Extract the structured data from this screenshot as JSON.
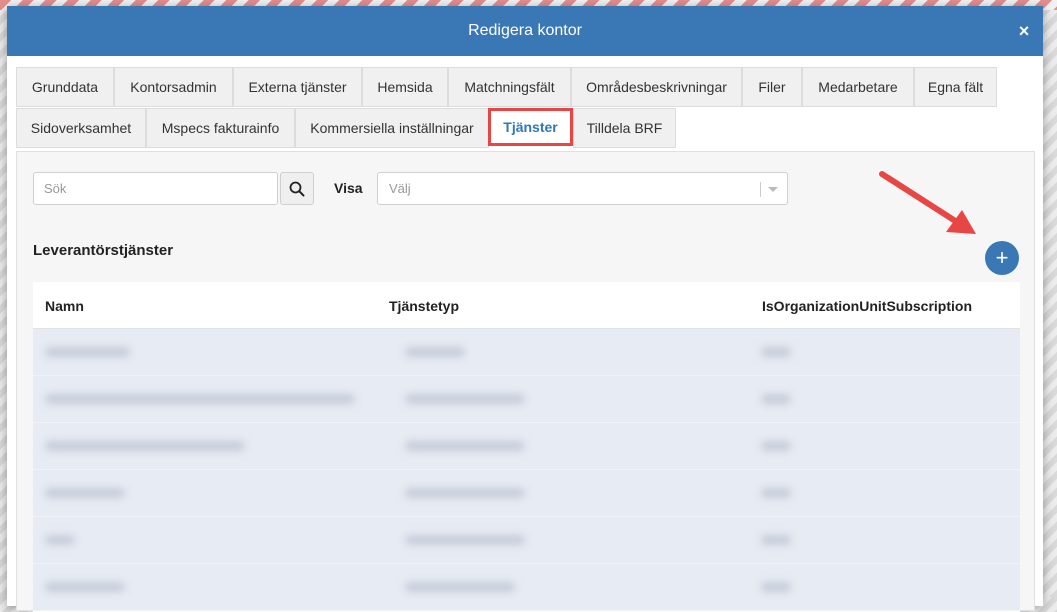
{
  "modal": {
    "title": "Redigera kontor",
    "close_glyph": "×"
  },
  "tabs": [
    {
      "label": "Grunddata",
      "active": false
    },
    {
      "label": "Kontorsadmin",
      "active": false
    },
    {
      "label": "Externa tjänster",
      "active": false
    },
    {
      "label": "Hemsida",
      "active": false
    },
    {
      "label": "Matchningsfält",
      "active": false
    },
    {
      "label": "Områdesbeskrivningar",
      "active": false
    },
    {
      "label": "Filer",
      "active": false
    },
    {
      "label": "Medarbetare",
      "active": false
    },
    {
      "label": "Egna fält",
      "active": false
    },
    {
      "label": "Sidoverksamhet",
      "active": false
    },
    {
      "label": "Mspecs fakturainfo",
      "active": false
    },
    {
      "label": "Kommersiella inställningar",
      "active": false
    },
    {
      "label": "Tjänster",
      "active": true
    },
    {
      "label": "Tilldela BRF",
      "active": false
    }
  ],
  "filters": {
    "search_placeholder": "Sök",
    "search_value": "",
    "search_icon": "search-icon",
    "visa_label": "Visa",
    "select_value": "Välj"
  },
  "section": {
    "title": "Leverantörstjänster",
    "add_glyph": "+"
  },
  "table": {
    "columns": [
      "Namn",
      "Tjänstetyp",
      "IsOrganizationUnitSubscription"
    ]
  },
  "colors": {
    "header": "#3a78b5",
    "active_tab_text": "#2f78b8",
    "highlight": "#e84545",
    "row_bg": "#e7ebf3"
  }
}
